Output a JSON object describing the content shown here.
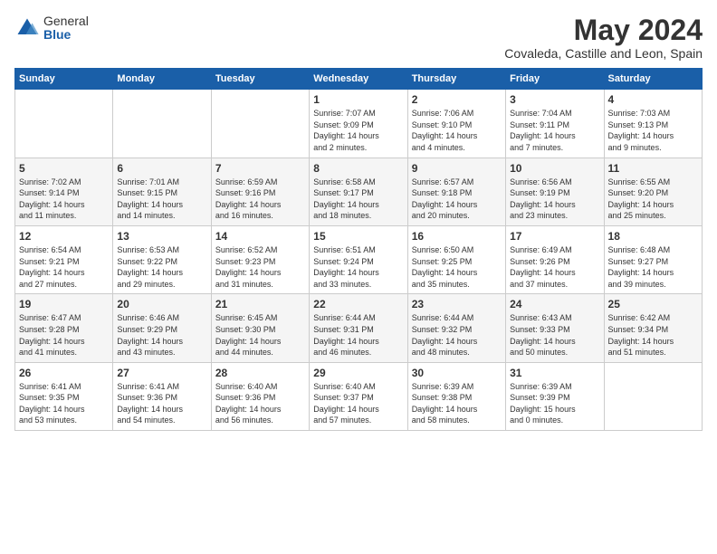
{
  "logo": {
    "general": "General",
    "blue": "Blue"
  },
  "header": {
    "month": "May 2024",
    "location": "Covaleda, Castille and Leon, Spain"
  },
  "weekdays": [
    "Sunday",
    "Monday",
    "Tuesday",
    "Wednesday",
    "Thursday",
    "Friday",
    "Saturday"
  ],
  "weeks": [
    [
      {
        "day": "",
        "info": ""
      },
      {
        "day": "",
        "info": ""
      },
      {
        "day": "",
        "info": ""
      },
      {
        "day": "1",
        "info": "Sunrise: 7:07 AM\nSunset: 9:09 PM\nDaylight: 14 hours\nand 2 minutes."
      },
      {
        "day": "2",
        "info": "Sunrise: 7:06 AM\nSunset: 9:10 PM\nDaylight: 14 hours\nand 4 minutes."
      },
      {
        "day": "3",
        "info": "Sunrise: 7:04 AM\nSunset: 9:11 PM\nDaylight: 14 hours\nand 7 minutes."
      },
      {
        "day": "4",
        "info": "Sunrise: 7:03 AM\nSunset: 9:13 PM\nDaylight: 14 hours\nand 9 minutes."
      }
    ],
    [
      {
        "day": "5",
        "info": "Sunrise: 7:02 AM\nSunset: 9:14 PM\nDaylight: 14 hours\nand 11 minutes."
      },
      {
        "day": "6",
        "info": "Sunrise: 7:01 AM\nSunset: 9:15 PM\nDaylight: 14 hours\nand 14 minutes."
      },
      {
        "day": "7",
        "info": "Sunrise: 6:59 AM\nSunset: 9:16 PM\nDaylight: 14 hours\nand 16 minutes."
      },
      {
        "day": "8",
        "info": "Sunrise: 6:58 AM\nSunset: 9:17 PM\nDaylight: 14 hours\nand 18 minutes."
      },
      {
        "day": "9",
        "info": "Sunrise: 6:57 AM\nSunset: 9:18 PM\nDaylight: 14 hours\nand 20 minutes."
      },
      {
        "day": "10",
        "info": "Sunrise: 6:56 AM\nSunset: 9:19 PM\nDaylight: 14 hours\nand 23 minutes."
      },
      {
        "day": "11",
        "info": "Sunrise: 6:55 AM\nSunset: 9:20 PM\nDaylight: 14 hours\nand 25 minutes."
      }
    ],
    [
      {
        "day": "12",
        "info": "Sunrise: 6:54 AM\nSunset: 9:21 PM\nDaylight: 14 hours\nand 27 minutes."
      },
      {
        "day": "13",
        "info": "Sunrise: 6:53 AM\nSunset: 9:22 PM\nDaylight: 14 hours\nand 29 minutes."
      },
      {
        "day": "14",
        "info": "Sunrise: 6:52 AM\nSunset: 9:23 PM\nDaylight: 14 hours\nand 31 minutes."
      },
      {
        "day": "15",
        "info": "Sunrise: 6:51 AM\nSunset: 9:24 PM\nDaylight: 14 hours\nand 33 minutes."
      },
      {
        "day": "16",
        "info": "Sunrise: 6:50 AM\nSunset: 9:25 PM\nDaylight: 14 hours\nand 35 minutes."
      },
      {
        "day": "17",
        "info": "Sunrise: 6:49 AM\nSunset: 9:26 PM\nDaylight: 14 hours\nand 37 minutes."
      },
      {
        "day": "18",
        "info": "Sunrise: 6:48 AM\nSunset: 9:27 PM\nDaylight: 14 hours\nand 39 minutes."
      }
    ],
    [
      {
        "day": "19",
        "info": "Sunrise: 6:47 AM\nSunset: 9:28 PM\nDaylight: 14 hours\nand 41 minutes."
      },
      {
        "day": "20",
        "info": "Sunrise: 6:46 AM\nSunset: 9:29 PM\nDaylight: 14 hours\nand 43 minutes."
      },
      {
        "day": "21",
        "info": "Sunrise: 6:45 AM\nSunset: 9:30 PM\nDaylight: 14 hours\nand 44 minutes."
      },
      {
        "day": "22",
        "info": "Sunrise: 6:44 AM\nSunset: 9:31 PM\nDaylight: 14 hours\nand 46 minutes."
      },
      {
        "day": "23",
        "info": "Sunrise: 6:44 AM\nSunset: 9:32 PM\nDaylight: 14 hours\nand 48 minutes."
      },
      {
        "day": "24",
        "info": "Sunrise: 6:43 AM\nSunset: 9:33 PM\nDaylight: 14 hours\nand 50 minutes."
      },
      {
        "day": "25",
        "info": "Sunrise: 6:42 AM\nSunset: 9:34 PM\nDaylight: 14 hours\nand 51 minutes."
      }
    ],
    [
      {
        "day": "26",
        "info": "Sunrise: 6:41 AM\nSunset: 9:35 PM\nDaylight: 14 hours\nand 53 minutes."
      },
      {
        "day": "27",
        "info": "Sunrise: 6:41 AM\nSunset: 9:36 PM\nDaylight: 14 hours\nand 54 minutes."
      },
      {
        "day": "28",
        "info": "Sunrise: 6:40 AM\nSunset: 9:36 PM\nDaylight: 14 hours\nand 56 minutes."
      },
      {
        "day": "29",
        "info": "Sunrise: 6:40 AM\nSunset: 9:37 PM\nDaylight: 14 hours\nand 57 minutes."
      },
      {
        "day": "30",
        "info": "Sunrise: 6:39 AM\nSunset: 9:38 PM\nDaylight: 14 hours\nand 58 minutes."
      },
      {
        "day": "31",
        "info": "Sunrise: 6:39 AM\nSunset: 9:39 PM\nDaylight: 15 hours\nand 0 minutes."
      },
      {
        "day": "",
        "info": ""
      }
    ]
  ]
}
